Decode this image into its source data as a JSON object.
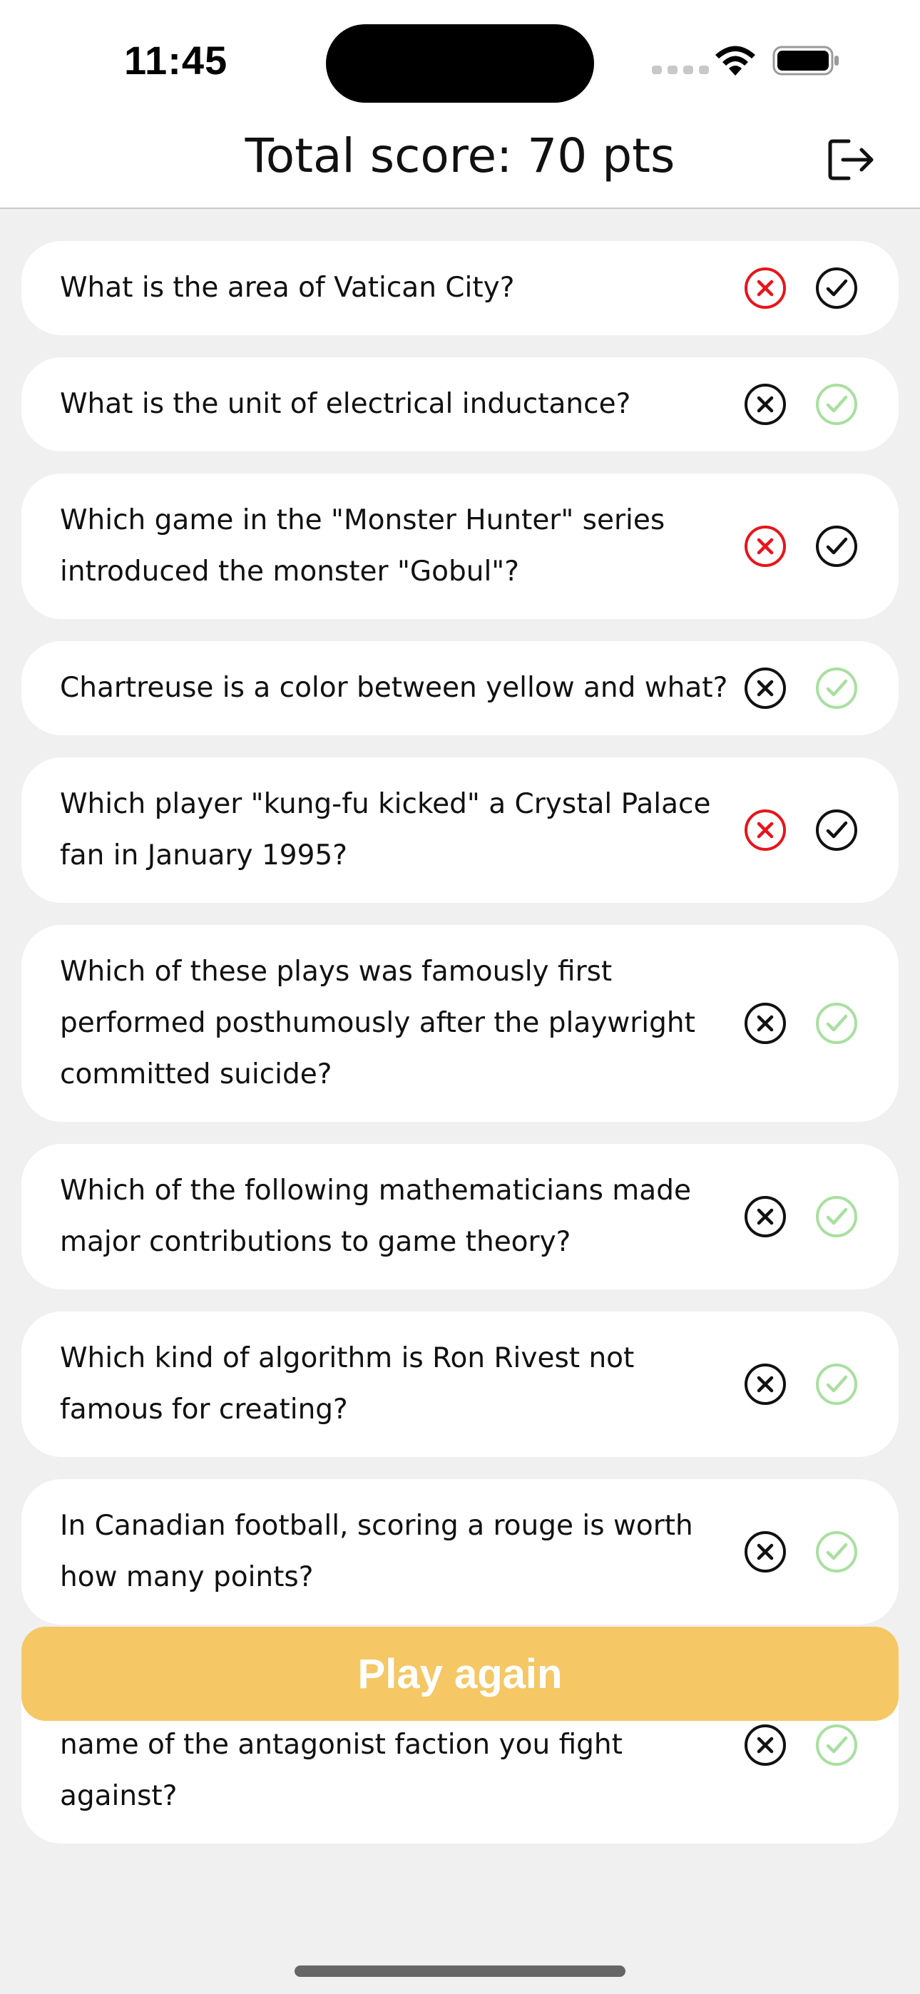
{
  "status_bar": {
    "time": "11:45"
  },
  "header": {
    "title": "Total score: 70 pts",
    "logout_icon": "logout-icon"
  },
  "colors": {
    "wrong_selected": "#e8141b",
    "correct_selected": "#a9dfa0",
    "default_icon": "#111111",
    "accent": "#f5c765"
  },
  "questions": [
    {
      "text": "What is the area of Vatican City?",
      "wrong_state": "highlighted",
      "correct_state": "default"
    },
    {
      "text": "What is the unit of electrical inductance?",
      "wrong_state": "default",
      "correct_state": "highlighted"
    },
    {
      "text": "Which game in the \"Monster Hunter\" series introduced the monster \"Gobul\"?",
      "wrong_state": "highlighted",
      "correct_state": "default"
    },
    {
      "text": "Chartreuse is a color between yellow and what?",
      "wrong_state": "default",
      "correct_state": "highlighted"
    },
    {
      "text": "Which player \"kung-fu kicked\" a Crystal Palace fan in January 1995?",
      "wrong_state": "highlighted",
      "correct_state": "default"
    },
    {
      "text": "Which of these plays was famously first performed posthumously after the playwright committed suicide?",
      "wrong_state": "default",
      "correct_state": "highlighted"
    },
    {
      "text": "Which of the following mathematicians made major contributions to game theory?",
      "wrong_state": "default",
      "correct_state": "highlighted"
    },
    {
      "text": "Which kind of algorithm is Ron Rivest not famous for creating?",
      "wrong_state": "default",
      "correct_state": "highlighted"
    },
    {
      "text": "In Canadian football, scoring a rouge is worth how many points?",
      "wrong_state": "default",
      "correct_state": "highlighted"
    },
    {
      "text": "In the SHMUP series, \"Gradius\", what is the name of the antagonist faction you fight against?",
      "wrong_state": "default",
      "correct_state": "highlighted"
    }
  ],
  "play_again": {
    "label": "Play again"
  }
}
